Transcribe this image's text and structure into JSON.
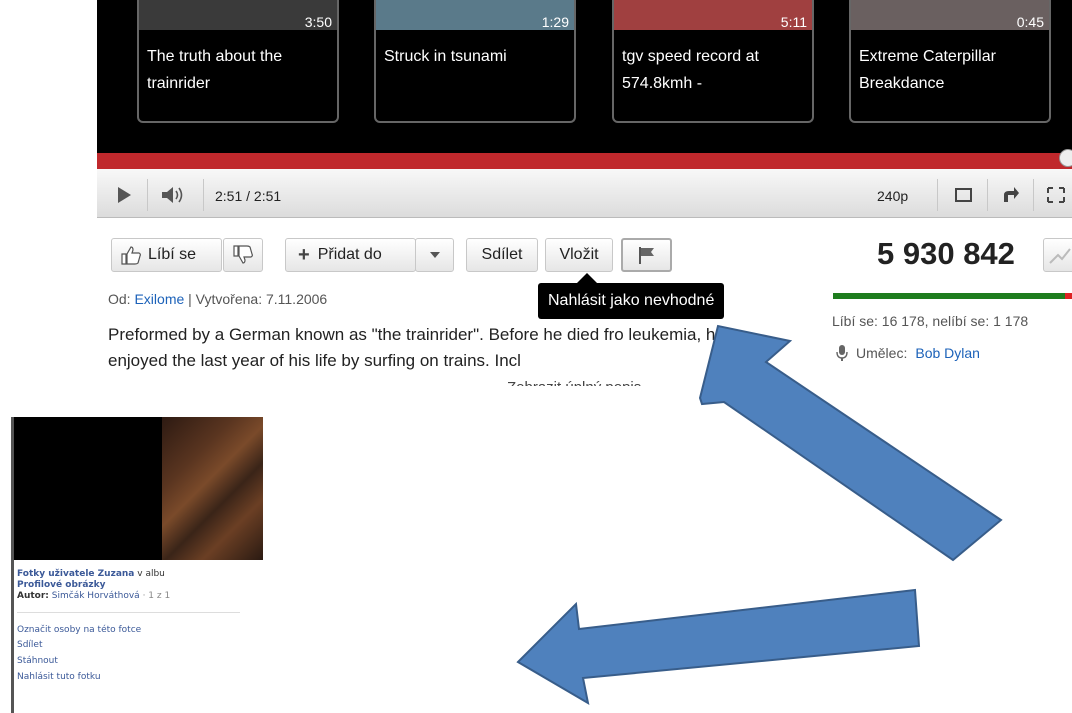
{
  "related": [
    {
      "duration": "3:50",
      "title": "The truth about the trainrider",
      "tint": "#3a3a3a"
    },
    {
      "duration": "1:29",
      "title": "Struck in tsunami",
      "tint": "#5a7a8a"
    },
    {
      "duration": "5:11",
      "title": "tgv speed record at 574.8kmh -",
      "tint": "#a04040"
    },
    {
      "duration": "0:45",
      "title": "Extreme Caterpillar Breakdance",
      "tint": "#6a6060"
    }
  ],
  "player": {
    "time": "2:51 / 2:51",
    "quality": "240p",
    "progress_fraction": 1.0,
    "accent": "#c0282c"
  },
  "actions": {
    "like_label": "Líbí se",
    "add_label": "Přidat do",
    "share_label": "Sdílet",
    "embed_label": "Vložit",
    "flag_tooltip": "Nahlásit jako nevhodné",
    "views": "5 930 842"
  },
  "info": {
    "from_prefix": "Od:",
    "uploader": "Exilome",
    "created": "| Vytvořena: 7.11.2006",
    "description": "Preformed by a German known as \"the trainrider\". Before he died fro leukemia, he enjoyed the last year of his life by surfing on trains. Incl",
    "show_more": "Zobrazit úplný popis ⌄",
    "likes": "Líbí se: 16 178, nelíbí se: 1 178",
    "artist_label": "Umělec:",
    "artist": "Bob Dylan"
  },
  "facebook": {
    "album_owner_prefix": "Fotky uživatele Zuzana",
    "album_in": " v albu",
    "album_name": "Profilové obrázky",
    "author_label": "Autor:",
    "author": "Simčák Horváthová",
    "count": " · 1 z 1",
    "actions": [
      "Označit osoby na této fotce",
      "Sdílet",
      "Stáhnout",
      "Nahlásit tuto fotku"
    ],
    "link_color": "#3b5998"
  },
  "arrows": {
    "color": "#4f81bd",
    "outline": "#385d8a"
  }
}
